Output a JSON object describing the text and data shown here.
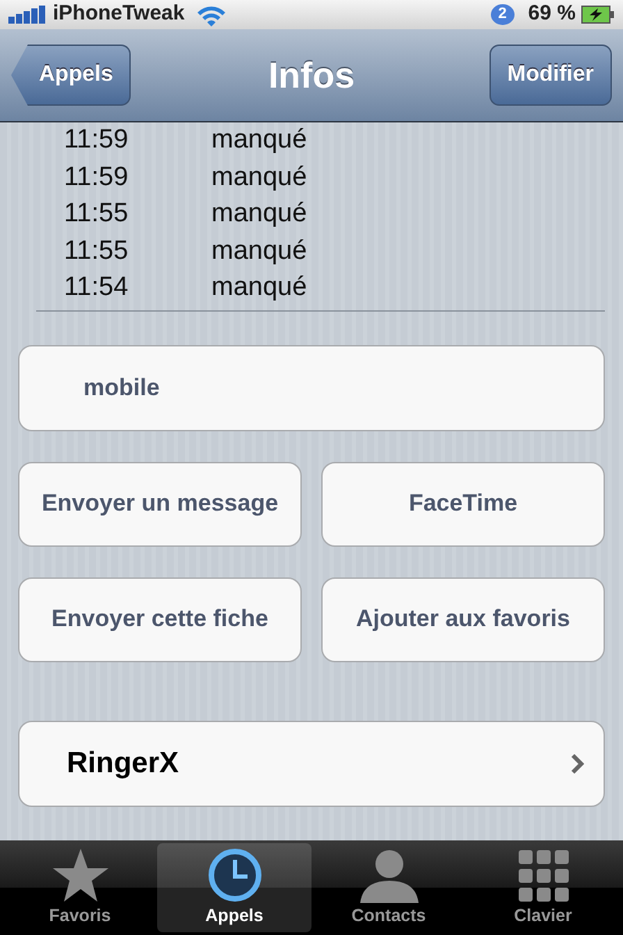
{
  "status_bar": {
    "carrier": "iPhoneTweak",
    "badge": "2",
    "battery": "69 %"
  },
  "nav_bar": {
    "back": "Appels",
    "title": "Infos",
    "action": "Modifier"
  },
  "calls": [
    {
      "time": "11:59",
      "status": "manqué"
    },
    {
      "time": "11:59",
      "status": "manqué"
    },
    {
      "time": "11:55",
      "status": "manqué"
    },
    {
      "time": "11:55",
      "status": "manqué"
    },
    {
      "time": "11:54",
      "status": "manqué"
    }
  ],
  "phone_label": "mobile",
  "actions": [
    [
      "Envoyer un message",
      "FaceTime"
    ],
    [
      "Envoyer cette fiche",
      "Ajouter aux favoris"
    ]
  ],
  "app_row": {
    "label": "RingerX"
  },
  "tab_bar": [
    {
      "label": "Favoris",
      "selected": false
    },
    {
      "label": "Appels",
      "selected": true
    },
    {
      "label": "Contacts",
      "selected": false
    },
    {
      "label": "Clavier",
      "selected": false
    }
  ]
}
